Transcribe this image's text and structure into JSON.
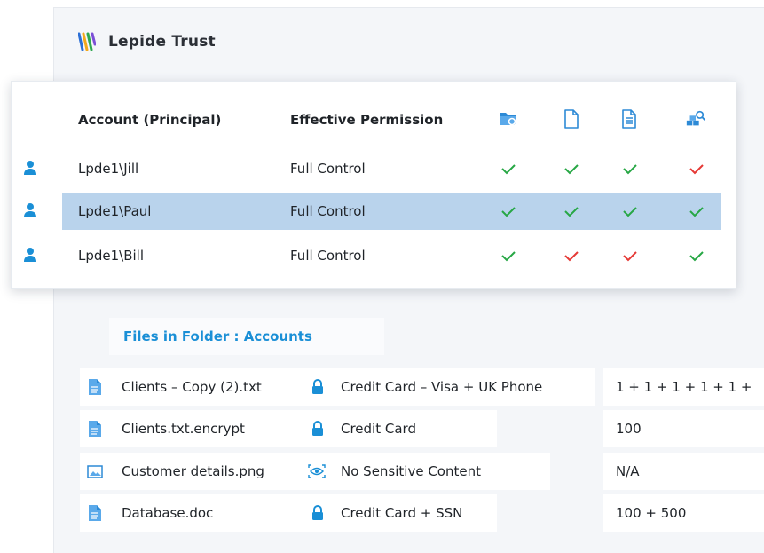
{
  "app": {
    "brand_name": "Lepide Trust"
  },
  "permissions_table": {
    "headers": {
      "account": "Account (Principal)",
      "permission": "Effective Permission",
      "icon_columns": [
        "folder-search-icon",
        "file-icon",
        "document-icon",
        "users-group-icon"
      ]
    },
    "rows": [
      {
        "account": "Lpde1\\Jill",
        "permission": "Full Control",
        "checks": [
          "green",
          "green",
          "green",
          "red"
        ],
        "selected": false
      },
      {
        "account": "Lpde1\\Paul",
        "permission": "Full Control",
        "checks": [
          "green",
          "green",
          "green",
          "green"
        ],
        "selected": true
      },
      {
        "account": "Lpde1\\Bill",
        "permission": "Full Control",
        "checks": [
          "green",
          "red",
          "red",
          "green"
        ],
        "selected": false
      }
    ]
  },
  "files": {
    "heading": "Files in Folder : Accounts",
    "rows": [
      {
        "name": "Clients – Copy (2).txt",
        "file_icon": "text-file-icon",
        "status_icon": "lock-icon",
        "classification": "Credit Card – Visa + UK Phone",
        "count": "1 + 1 + 1 + 1 + 1 +"
      },
      {
        "name": "Clients.txt.encrypt",
        "file_icon": "text-file-icon",
        "status_icon": "lock-icon",
        "classification": "Credit Card",
        "count": "100"
      },
      {
        "name": "Customer details.png",
        "file_icon": "image-file-icon",
        "status_icon": "eye-scan-icon",
        "classification": "No Sensitive Content",
        "count": "N/A"
      },
      {
        "name": "Database.doc",
        "file_icon": "text-file-icon",
        "status_icon": "lock-icon",
        "classification": "Credit Card + SSN",
        "count": "100 + 500"
      }
    ]
  },
  "colors": {
    "accent_blue": "#1a8fd6",
    "check_green": "#27a745",
    "check_red": "#e53935",
    "row_highlight": "#b9d3ec"
  }
}
